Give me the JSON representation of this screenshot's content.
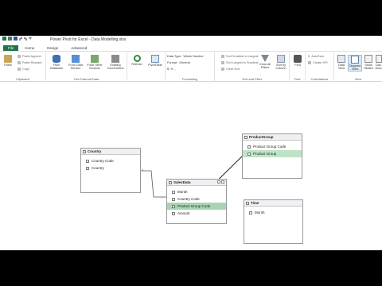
{
  "window": {
    "title": "Power Pivot for Excel - Data Modelling.xlsx"
  },
  "tabs": [
    {
      "label": "File",
      "active": false
    },
    {
      "label": "Home",
      "active": true
    },
    {
      "label": "Design",
      "active": false
    },
    {
      "label": "Advanced",
      "active": false
    }
  ],
  "ribbon": {
    "clipboard": {
      "label": "Clipboard",
      "paste": "Paste",
      "paste_append": "Paste Append",
      "paste_replace": "Paste Replace",
      "copy": "Copy"
    },
    "get_external_data": {
      "label": "Get External Data",
      "from_database": "From Database",
      "from_data_service": "From Data Service",
      "from_other_sources": "From Other Sources",
      "existing_connections": "Existing Connections"
    },
    "refresh": "Refresh",
    "pivottable": "PivotTable",
    "formatting": {
      "label": "Formatting",
      "data_type": "Data Type : Whole Number",
      "format": "Format : General",
      "currency": "$",
      "percent": "%",
      "comma": ","
    },
    "sort_filter": {
      "label": "Sort and Filter",
      "sort_smallest_largest": "Sort Smallest to Largest",
      "sort_largest_smallest": "Sort Largest to Smallest",
      "clear_sort": "Clear Sort",
      "clear_all_filters": "Clear All Filters",
      "sort_by_column": "Sort by Column"
    },
    "find": {
      "label": "Find",
      "button": "Find"
    },
    "calculations": {
      "label": "Calculations",
      "autosum": "AutoSum",
      "create_kpi": "Create KPI"
    },
    "view": {
      "label": "View",
      "data_view": "Data View",
      "diagram_view": "Diagram View",
      "show_hidden": "Show Hidden",
      "calculation_area": "Calc Area"
    }
  },
  "diagram": {
    "tables": [
      {
        "name": "Country",
        "fields": [
          "Country Code",
          "Country"
        ]
      },
      {
        "name": "SalesData",
        "fields": [
          "Month",
          "Country Code",
          "Product Group Code",
          "Amount"
        ]
      },
      {
        "name": "ProductGroup",
        "fields": [
          "Product Group Code",
          "Product Group"
        ]
      },
      {
        "name": "Time",
        "fields": [
          "Month"
        ]
      }
    ],
    "relationship_labels": {
      "one": "1",
      "many": "*"
    }
  }
}
